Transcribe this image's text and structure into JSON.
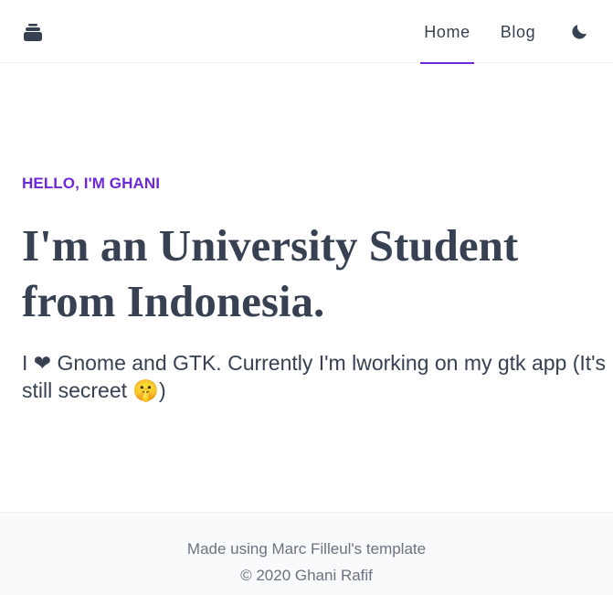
{
  "header": {
    "logo_icon": "cake-icon",
    "nav": [
      {
        "label": "Home",
        "active": true
      },
      {
        "label": "Blog",
        "active": false
      }
    ],
    "theme_toggle_icon": "moon-icon",
    "accent_color": "#6d28d9"
  },
  "hero": {
    "kicker": "HELLO, I'M GHANI",
    "headline": "I'm an University Student from Indonesia.",
    "intro": "I ❤ Gnome and GTK. Currently I'm lworking on my gtk app (It's still secreet 🤫)"
  },
  "footer": {
    "credit": "Made using Marc Filleul's template",
    "copyright": "© 2020 Ghani Rafif"
  }
}
